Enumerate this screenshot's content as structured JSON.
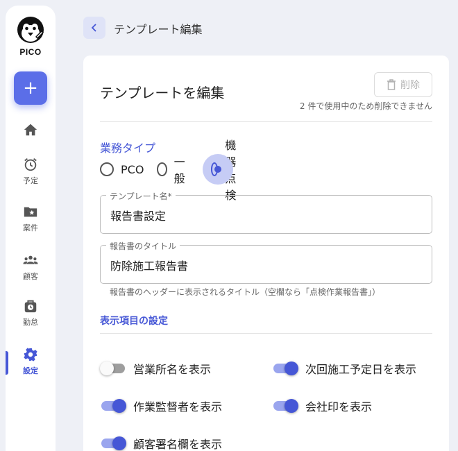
{
  "app": {
    "logo_text": "PICO"
  },
  "sidebar": {
    "add_label": "+",
    "items": [
      {
        "label": "",
        "icon": "home-icon"
      },
      {
        "label": "予定",
        "icon": "alarm-clock-icon"
      },
      {
        "label": "案件",
        "icon": "star-folder-icon"
      },
      {
        "label": "顧客",
        "icon": "group-icon"
      },
      {
        "label": "勤怠",
        "icon": "time-bag-icon"
      },
      {
        "label": "設定",
        "icon": "gear-icon",
        "active": true
      }
    ]
  },
  "header": {
    "title": "テンプレート編集"
  },
  "card": {
    "title": "テンプレートを編集",
    "delete_label": "削除",
    "delete_note": "2 件で使用中のため削除できません"
  },
  "business_type": {
    "label": "業務タイプ",
    "options": [
      "PCO",
      "一般",
      "機器点検"
    ],
    "selected": "機器点検"
  },
  "template_name": {
    "label": "テンプレート名*",
    "value": "報告書設定"
  },
  "report_title": {
    "label": "報告書のタイトル",
    "value": "防除施工報告書",
    "helper": "報告書のヘッダーに表示されるタイトル（空欄なら「点検作業報告書」）"
  },
  "display_settings": {
    "label": "表示項目の設定",
    "toggles": [
      {
        "label": "営業所名を表示",
        "on": false
      },
      {
        "label": "次回施工予定日を表示",
        "on": true
      },
      {
        "label": "作業監督者を表示",
        "on": true
      },
      {
        "label": "会社印を表示",
        "on": true
      },
      {
        "label": "顧客署名欄を表示",
        "on": true
      }
    ]
  },
  "colors": {
    "accent": "#4657d6",
    "fab": "#5b6ee8",
    "background": "#eef0f6"
  }
}
